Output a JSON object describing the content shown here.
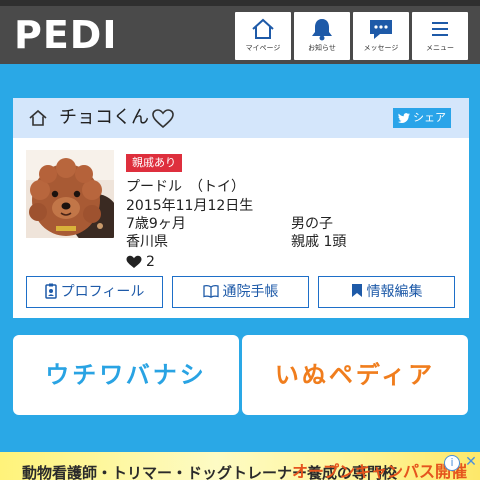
{
  "app": {
    "logo": "PEDI"
  },
  "nav": {
    "items": [
      {
        "label": "マイページ",
        "icon": "home-icon"
      },
      {
        "label": "お知らせ",
        "icon": "bell-icon"
      },
      {
        "label": "メッセージ",
        "icon": "message-icon"
      },
      {
        "label": "メニュー",
        "icon": "menu-icon"
      }
    ]
  },
  "pet": {
    "name": "チョコくん",
    "share_label": "シェア",
    "badge": "親戚あり",
    "breed": "プードル　（トイ）",
    "birthday": "2015年11月12日生",
    "age": "7歳9ヶ月",
    "sex": "男の子",
    "prefecture": "香川県",
    "relatives": "親戚 1頭",
    "likes": "2"
  },
  "actions": [
    {
      "label": "プロフィール",
      "icon": "profile-icon"
    },
    {
      "label": "通院手帳",
      "icon": "book-icon"
    },
    {
      "label": "情報編集",
      "icon": "bookmark-icon"
    }
  ],
  "banners": {
    "left": {
      "label": "ウチワバナシ",
      "color": "#29a3e3"
    },
    "right": {
      "label": "いぬペディア",
      "color": "#f07d1d"
    }
  },
  "ad": {
    "left_text": "動物看護師・トリマー・ドッグトレーナー養成の専門校",
    "right_text": "オープンキャンパス開催",
    "info_label": "i",
    "close_label": "✕"
  },
  "colors": {
    "background": "#2aa8e6",
    "topbar": "#4a4a4a",
    "card_header": "#d4e6fb",
    "badge": "#de2f3d",
    "share": "#2aa4e9",
    "action_text": "#1e5aa8"
  }
}
